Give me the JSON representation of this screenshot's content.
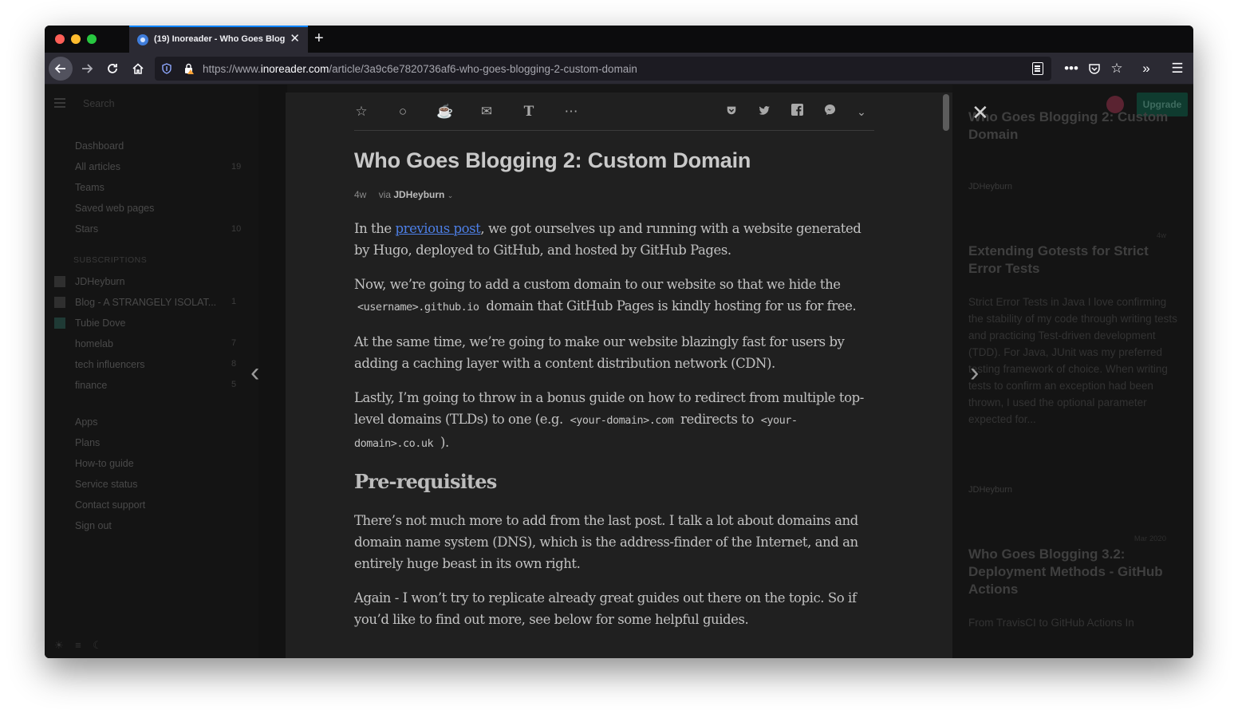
{
  "browser": {
    "tab_title": "(19) Inoreader - Who Goes Blog",
    "tab_close": "✕",
    "new_tab": "+",
    "url_prefix": "https://www.",
    "url_domain": "inoreader.com",
    "url_path": "/article/3a9c6e7820736af6-who-goes-blogging-2-custom-domain",
    "accent": "#0a84ff"
  },
  "sidebar": {
    "search": "Search",
    "items": [
      {
        "label": "Dashboard",
        "count": ""
      },
      {
        "label": "All articles",
        "count": "19"
      },
      {
        "label": "Teams",
        "count": ""
      },
      {
        "label": "Saved web pages",
        "count": ""
      },
      {
        "label": "Stars",
        "count": "10"
      }
    ],
    "subscriptions_label": "SUBSCRIPTIONS",
    "feeds": [
      {
        "label": "JDHeyburn",
        "count": ""
      },
      {
        "label": "Blog - A STRANGELY ISOLAT...",
        "count": "1"
      },
      {
        "label": "Tubie Dove",
        "count": ""
      },
      {
        "label": "homelab",
        "count": "7"
      },
      {
        "label": "tech influencers",
        "count": "8"
      },
      {
        "label": "finance",
        "count": "5"
      }
    ],
    "links": [
      "Apps",
      "Plans",
      "How-to guide",
      "Service status",
      "Contact support",
      "Sign out"
    ]
  },
  "right_panel": {
    "upgrade": "Upgrade",
    "cards": [
      {
        "title": "Who Goes Blogging 2: Custom Domain",
        "author": "JDHeyburn",
        "date": "",
        "body": ""
      },
      {
        "title": "Extending Gotests for Strict Error Tests",
        "author": "JDHeyburn",
        "date": "4w",
        "body": "Strict Error Tests in Java I love confirming the stability of my code through writing tests and practicing Test-driven development (TDD). For Java, JUnit was my preferred testing framework of choice. When writing tests to confirm an exception had been thrown, I used the optional parameter expected for..."
      },
      {
        "title": "Who Goes Blogging 3.2: Deployment Methods - GitHub Actions",
        "author": "",
        "date": "Mar 2020",
        "body": "From TravisCI to GitHub Actions In"
      }
    ]
  },
  "article": {
    "title": "Who Goes Blogging 2: Custom Domain",
    "age": "4w",
    "via": "via",
    "author": "JDHeyburn",
    "p1_a": "In the ",
    "p1_link": "previous post",
    "p1_b": ", we got ourselves up and running with a website generated by Hugo, deployed to GitHub, and hosted by GitHub Pages.",
    "p2_a": "Now, we’re going to add a custom domain to our website so that we hide the ",
    "p2_code": "<username>.github.io",
    "p2_b": " domain that GitHub Pages is kindly hosting for us for free.",
    "p3": "At the same time, we’re going to make our website blazingly fast for users by adding a caching layer with a content distribution network (CDN).",
    "p4_a": "Lastly, I’m going to throw in a bonus guide on how to redirect from multiple top-level domains (TLDs) to one (e.g. ",
    "p4_code1": "<your-domain>.com",
    "p4_b": " redirects to ",
    "p4_code2": "<your-domain>.co.uk",
    "p4_c": " ).",
    "h2": "Pre-requisites",
    "p5": "There’s not much more to add from the last post. I talk a lot about domains and domain name system (DNS), which is the address-finder of the Internet, and an entirely huge beast in its own right.",
    "p6": "Again - I won’t try to replicate already great guides out there on the topic. So if you’d like to find out more, see below for some helpful guides.",
    "link_color": "#4d7fe6"
  },
  "toolbar_icons": [
    "star-icon",
    "circle-icon",
    "coffee-icon",
    "mail-icon",
    "text-icon",
    "more-icon",
    "pocket-icon",
    "twitter-icon",
    "facebook-icon",
    "messenger-icon",
    "chevron-down-icon"
  ]
}
